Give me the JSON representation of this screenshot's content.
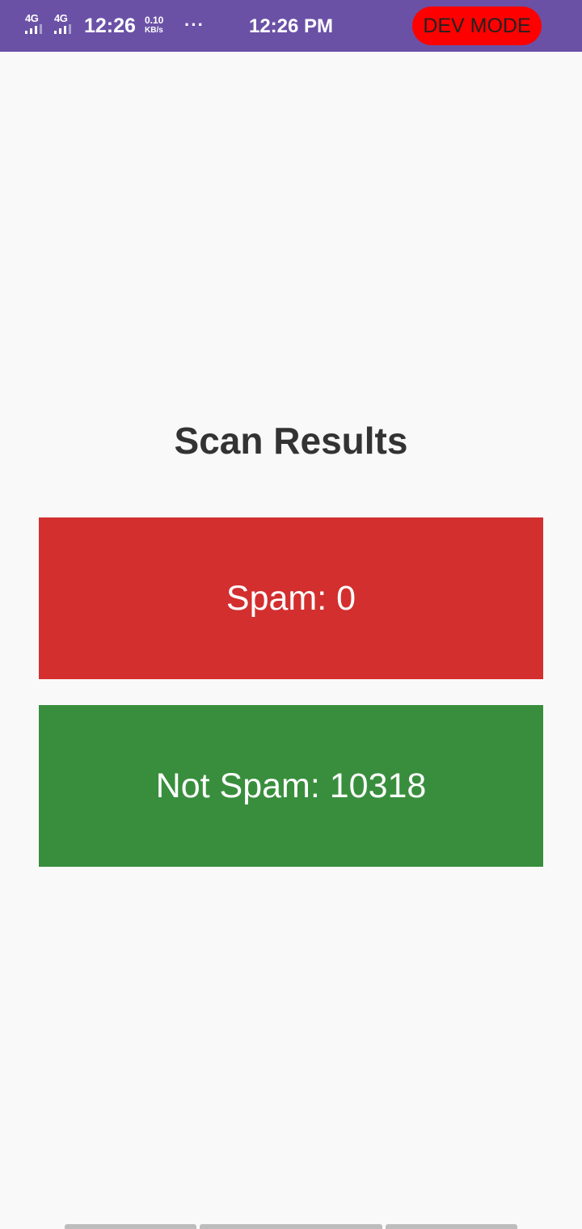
{
  "status_bar": {
    "network_1": "4G",
    "network_2": "4G",
    "time_left": "12:26",
    "speed_value": "0.10",
    "speed_unit": "KB/s",
    "more_indicator": "···",
    "time_center": "12:26 PM",
    "dev_mode_label": "DEV MODE"
  },
  "screen": {
    "title": "Scan Results",
    "spam_label": "Spam: 0",
    "not_spam_label": "Not Spam: 10318"
  },
  "colors": {
    "status_bar": "#6a51a6",
    "dev_mode": "#ff0000",
    "spam": "#d32f2f",
    "not_spam": "#388e3c",
    "background": "#f9f9f9"
  }
}
